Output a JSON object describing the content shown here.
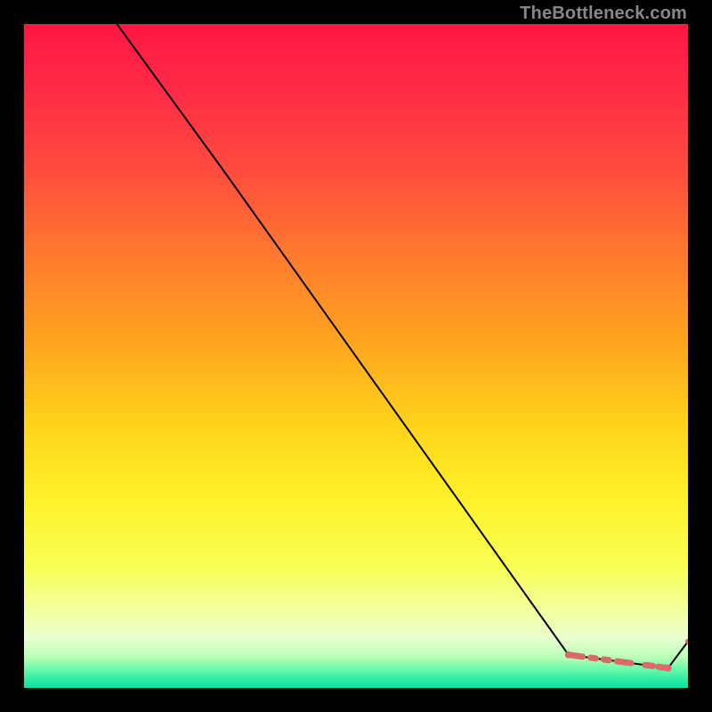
{
  "watermark": "TheBottleneck.com",
  "colors": {
    "page_bg": "#000000",
    "curve_stroke": "#000000",
    "marker_fill": "#d86a6a",
    "gradient_stops": [
      {
        "offset": 0.0,
        "color": "#ff1744"
      },
      {
        "offset": 0.1,
        "color": "#ff2b46"
      },
      {
        "offset": 0.22,
        "color": "#ff4b3e"
      },
      {
        "offset": 0.35,
        "color": "#ff7a2e"
      },
      {
        "offset": 0.48,
        "color": "#ffa51f"
      },
      {
        "offset": 0.6,
        "color": "#ffd21a"
      },
      {
        "offset": 0.72,
        "color": "#fff22a"
      },
      {
        "offset": 0.82,
        "color": "#f8ff55"
      },
      {
        "offset": 0.885,
        "color": "#f4ffa0"
      },
      {
        "offset": 0.925,
        "color": "#e8ffd0"
      },
      {
        "offset": 0.955,
        "color": "#b6ffb6"
      },
      {
        "offset": 0.975,
        "color": "#5cf7a8"
      },
      {
        "offset": 0.992,
        "color": "#1ce8a0"
      },
      {
        "offset": 1.0,
        "color": "#14d8a0"
      }
    ]
  },
  "chart_data": {
    "type": "line",
    "title": "",
    "xlabel": "",
    "ylabel": "",
    "xlim": [
      0,
      100
    ],
    "ylim": [
      0,
      100
    ],
    "grid": false,
    "curve": {
      "x": [
        14,
        30,
        82,
        97,
        100
      ],
      "y": [
        100,
        78,
        5,
        3,
        7
      ]
    },
    "emphasis_segment": {
      "x": [
        82,
        97
      ],
      "y": [
        5,
        3
      ]
    },
    "markers": [
      {
        "x": 82,
        "y": 5,
        "r": 4.0
      },
      {
        "x": 97,
        "y": 3,
        "r": 4.0
      },
      {
        "x": 100,
        "y": 7,
        "r": 3.0
      }
    ]
  }
}
